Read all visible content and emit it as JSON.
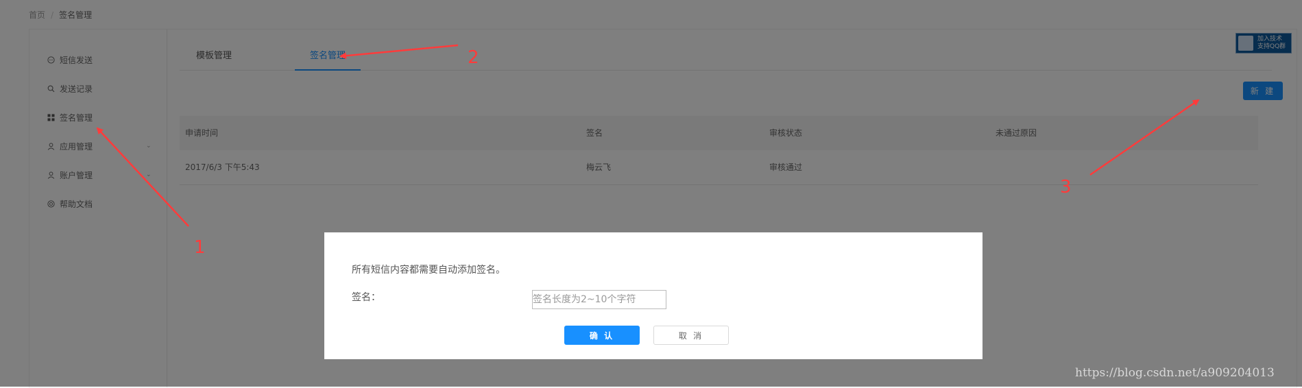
{
  "breadcrumb": {
    "home": "首页",
    "separator": "/",
    "current": "签名管理"
  },
  "sidebar": {
    "items": [
      {
        "label": "短信发送",
        "icon": "chat-bubble-icon"
      },
      {
        "label": "发送记录",
        "icon": "search-icon"
      },
      {
        "label": "签名管理",
        "icon": "grid-icon"
      },
      {
        "label": "应用管理",
        "icon": "user-icon"
      },
      {
        "label": "账户管理",
        "icon": "user-icon"
      },
      {
        "label": "帮助文档",
        "icon": "help-icon"
      }
    ]
  },
  "tabs": [
    {
      "label": "模板管理",
      "active": false
    },
    {
      "label": "签名管理",
      "active": true
    }
  ],
  "toolbar": {
    "new_label": "新 建"
  },
  "table": {
    "headers": [
      "申请时间",
      "签名",
      "审核状态",
      "未通过原因"
    ],
    "rows": [
      [
        "2017/6/3 下午5:43",
        "梅云飞",
        "审核通过",
        ""
      ]
    ]
  },
  "qq_badge": {
    "line1": "加入技术",
    "line2": "支持QQ群"
  },
  "modal": {
    "description": "所有短信内容都需要自动添加签名。",
    "label": "签名：",
    "input_value": "",
    "input_placeholder": "签名长度为2~10个字符",
    "ok_label": "确 认",
    "cancel_label": "取 消"
  },
  "annotations": {
    "n1": "1",
    "n2": "2",
    "n3": "3",
    "color": "#ff3b3b"
  },
  "colors": {
    "accent": "#1890ff",
    "overlay": "rgba(0,0,0,0.5)"
  },
  "watermark": "https://blog.csdn.net/a909204013"
}
